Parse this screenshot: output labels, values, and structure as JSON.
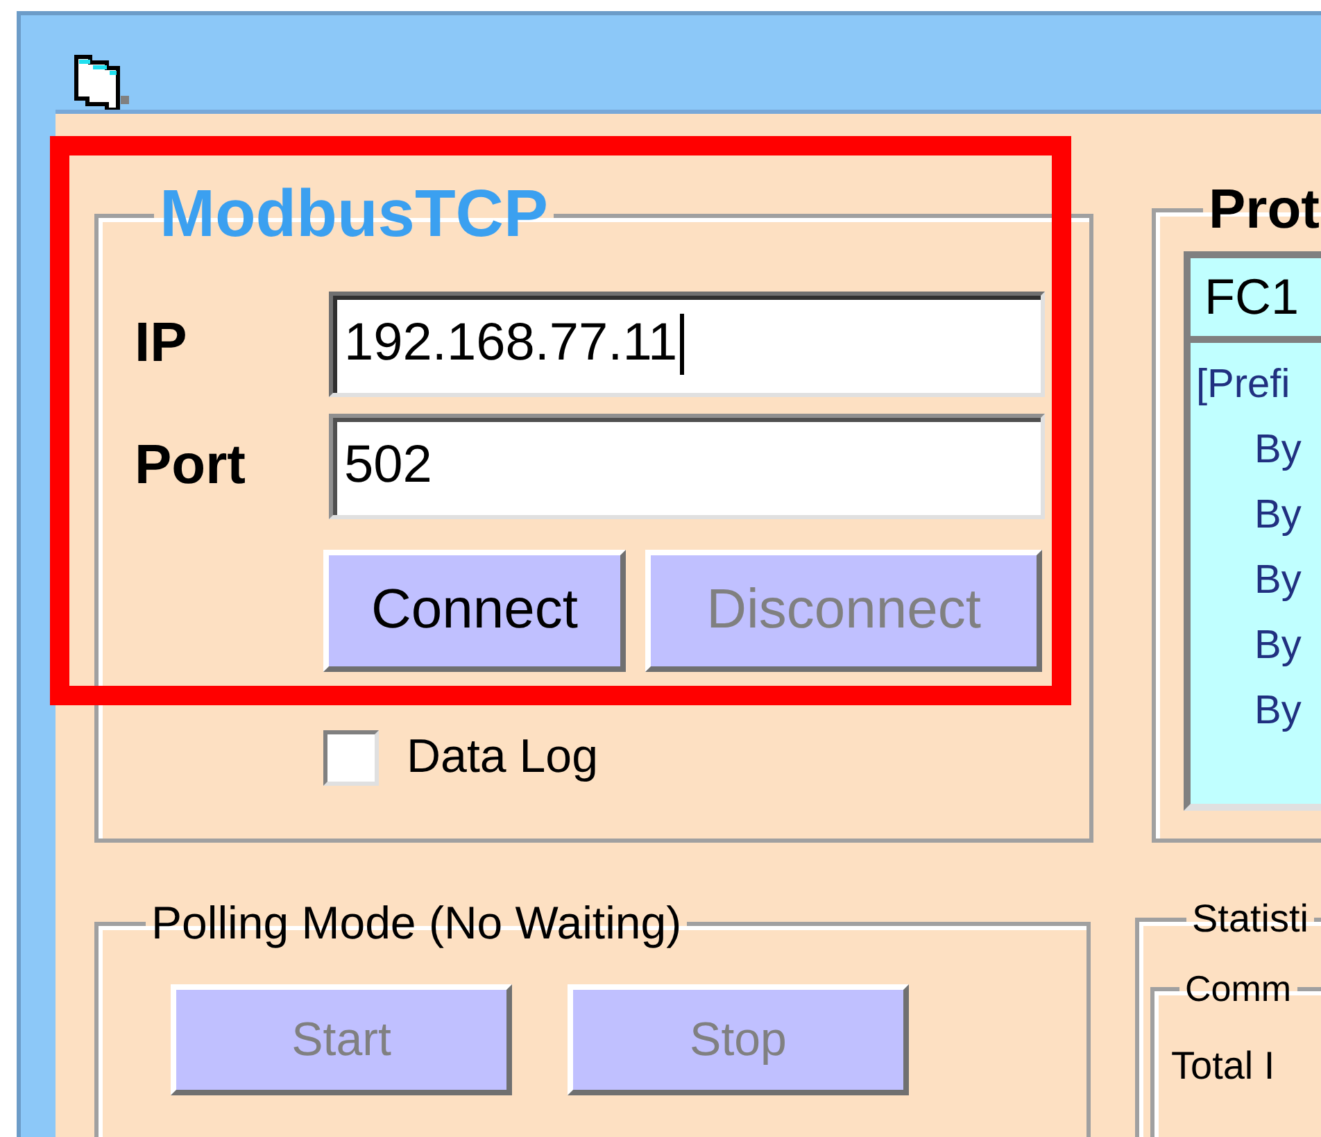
{
  "modbus": {
    "title": "ModbusTCP",
    "fields": [
      {
        "label": "IP",
        "value": "192.168.77.11",
        "focused": true
      },
      {
        "label": "Port",
        "value": "502",
        "focused": false
      }
    ],
    "buttons": [
      {
        "label": "Connect",
        "disabled": false
      },
      {
        "label": "Disconnect",
        "disabled": true
      }
    ],
    "data_log": {
      "label": "Data Log",
      "checked": false
    }
  },
  "protocol": {
    "title": "Prot",
    "function": "FC1",
    "lines": [
      {
        "text": "[Prefi",
        "kind": "header"
      },
      {
        "text": "By",
        "kind": "item"
      },
      {
        "text": "By",
        "kind": "item"
      },
      {
        "text": "By",
        "kind": "item"
      },
      {
        "text": "By",
        "kind": "item"
      },
      {
        "text": "By",
        "kind": "item"
      }
    ]
  },
  "polling": {
    "title": "Polling Mode (No Waiting)",
    "buttons": [
      {
        "label": "Start",
        "disabled": true
      },
      {
        "label": "Stop",
        "disabled": true
      }
    ]
  },
  "statistics": {
    "title": "Statisti",
    "group": {
      "title": "Comm",
      "lines": [
        "Total I"
      ]
    }
  }
}
